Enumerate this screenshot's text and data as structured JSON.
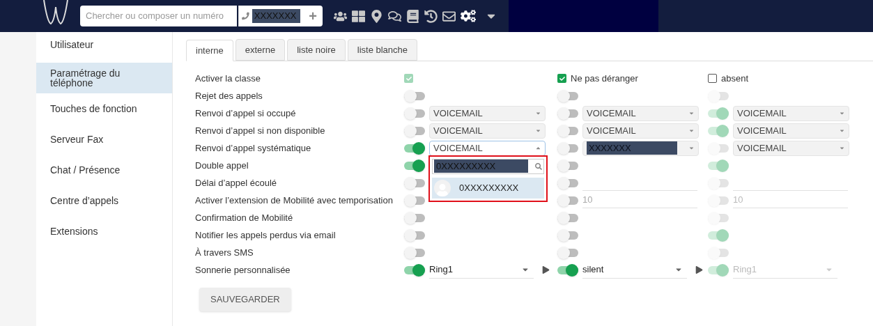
{
  "topbar": {
    "search": {
      "placeholder": "Chercher ou composer un numéro"
    },
    "phone": {
      "value": "XXXXXXX"
    },
    "add": "+"
  },
  "sidebar": {
    "items": [
      {
        "label": "Utilisateur",
        "selected": false
      },
      {
        "label": "Paramétrage du téléphone",
        "selected": true
      },
      {
        "label": "Touches de fonction",
        "selected": false
      },
      {
        "label": "Serveur Fax",
        "selected": false
      },
      {
        "label": "Chat / Présence",
        "selected": false
      },
      {
        "label": "Centre d’appels",
        "selected": false
      },
      {
        "label": "Extensions",
        "selected": false
      }
    ]
  },
  "tabs": [
    {
      "label": "interne",
      "selected": true
    },
    {
      "label": "externe",
      "selected": false
    },
    {
      "label": "liste noire",
      "selected": false
    },
    {
      "label": "liste blanche",
      "selected": false
    }
  ],
  "rows": [
    {
      "label": "Activer la classe",
      "cells": [
        {
          "kind": "checkbox",
          "checked": true,
          "disabled": true
        },
        {
          "kind": "checkbox",
          "checked": true,
          "disabled": false,
          "text": "Ne pas déranger"
        },
        {
          "kind": "checkbox",
          "checked": false,
          "disabled": false,
          "text": "absent"
        }
      ]
    },
    {
      "label": "Rejet des appels",
      "cells": [
        {
          "kind": "toggle",
          "on": false,
          "disabled": false
        },
        {
          "kind": "toggle",
          "on": false,
          "disabled": false
        },
        {
          "kind": "toggle",
          "on": false,
          "disabled": true
        }
      ]
    },
    {
      "label": "Renvoi d’appel si occupé",
      "cells": [
        {
          "kind": "toggle",
          "on": false,
          "disabled": false,
          "field": {
            "kind": "select",
            "value": "VOICEMAIL",
            "redacted": false,
            "expanded": false
          }
        },
        {
          "kind": "toggle",
          "on": false,
          "disabled": false,
          "field": {
            "kind": "select",
            "value": "VOICEMAIL",
            "redacted": false,
            "expanded": false
          }
        },
        {
          "kind": "toggle",
          "on": true,
          "disabled": true,
          "field": {
            "kind": "select",
            "value": "VOICEMAIL",
            "redacted": false,
            "expanded": false
          }
        }
      ]
    },
    {
      "label": "Renvoi d’appel si non disponible",
      "cells": [
        {
          "kind": "toggle",
          "on": false,
          "disabled": false,
          "field": {
            "kind": "select",
            "value": "VOICEMAIL",
            "redacted": false,
            "expanded": false
          }
        },
        {
          "kind": "toggle",
          "on": false,
          "disabled": false,
          "field": {
            "kind": "select",
            "value": "VOICEMAIL",
            "redacted": false,
            "expanded": false
          }
        },
        {
          "kind": "toggle",
          "on": true,
          "disabled": true,
          "field": {
            "kind": "select",
            "value": "VOICEMAIL",
            "redacted": false,
            "expanded": false
          }
        }
      ]
    },
    {
      "label": "Renvoi d’appel systématique",
      "cells": [
        {
          "kind": "toggle",
          "on": true,
          "disabled": false,
          "field": {
            "kind": "select",
            "value": "VOICEMAIL",
            "redacted": false,
            "expanded": true,
            "dropdown": {
              "search": "0XXXXXXXXX",
              "option": "0XXXXXXXXX"
            }
          }
        },
        {
          "kind": "toggle",
          "on": false,
          "disabled": false,
          "field": {
            "kind": "select",
            "value": "XXXXXXX",
            "redacted": true,
            "expanded": false
          }
        },
        {
          "kind": "toggle",
          "on": false,
          "disabled": true,
          "field": {
            "kind": "select",
            "value": "VOICEMAIL",
            "redacted": false,
            "expanded": false
          }
        }
      ]
    },
    {
      "label": "Double appel",
      "cells": [
        {
          "kind": "toggle",
          "on": true,
          "disabled": false
        },
        {
          "kind": "toggle",
          "on": false,
          "disabled": false
        },
        {
          "kind": "toggle",
          "on": true,
          "disabled": true
        }
      ]
    },
    {
      "label": "Délai d’appel écoulé",
      "cells": [
        {
          "kind": "toggle",
          "on": false,
          "disabled": false
        },
        {
          "kind": "toggle",
          "on": false,
          "disabled": false,
          "field": {
            "kind": "input"
          }
        },
        {
          "kind": "toggle",
          "on": false,
          "disabled": true,
          "field": {
            "kind": "input"
          }
        }
      ]
    },
    {
      "label": "Activer l’extension de Mobilité avec temporisation",
      "cells": [
        {
          "kind": "toggle",
          "on": false,
          "disabled": false
        },
        {
          "kind": "toggle",
          "on": false,
          "disabled": false,
          "field": {
            "kind": "input",
            "value": "10"
          }
        },
        {
          "kind": "toggle",
          "on": false,
          "disabled": true,
          "field": {
            "kind": "input",
            "value": "10"
          }
        }
      ]
    },
    {
      "label": "Confirmation de Mobilité",
      "cells": [
        {
          "kind": "toggle",
          "on": false,
          "disabled": false
        },
        {
          "kind": "toggle",
          "on": false,
          "disabled": false
        },
        {
          "kind": "toggle",
          "on": false,
          "disabled": true
        }
      ]
    },
    {
      "label": "Notifier les appels perdus via email",
      "cells": [
        {
          "kind": "toggle",
          "on": false,
          "disabled": false
        },
        {
          "kind": "toggle",
          "on": false,
          "disabled": false
        },
        {
          "kind": "toggle",
          "on": true,
          "disabled": true
        }
      ]
    },
    {
      "label": "À travers SMS",
      "cells": [
        {
          "kind": "toggle",
          "on": false,
          "disabled": false
        },
        {
          "kind": "toggle",
          "on": false,
          "disabled": false
        },
        {
          "kind": "toggle",
          "on": false,
          "disabled": true
        }
      ]
    },
    {
      "label": "Sonnerie personnalisée",
      "cells": [
        {
          "kind": "toggle",
          "on": true,
          "disabled": false,
          "field": {
            "kind": "ring",
            "value": "Ring1",
            "play": true
          }
        },
        {
          "kind": "toggle",
          "on": true,
          "disabled": false,
          "field": {
            "kind": "ring",
            "value": "silent",
            "play": true
          }
        },
        {
          "kind": "toggle",
          "on": true,
          "disabled": true,
          "field": {
            "kind": "ring",
            "value": "Ring1",
            "play": false
          }
        }
      ]
    }
  ],
  "save": "SAUVEGARDER"
}
